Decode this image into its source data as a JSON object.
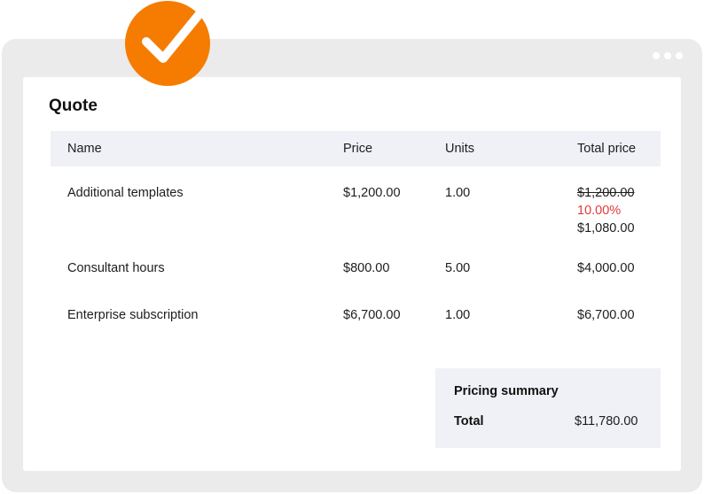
{
  "quote": {
    "title": "Quote",
    "columns": {
      "name": "Name",
      "price": "Price",
      "units": "Units",
      "total": "Total price"
    },
    "rows": [
      {
        "name": "Additional templates",
        "price": "$1,200.00",
        "units": "1.00",
        "original_total": "$1,200.00",
        "discount": "10.00%",
        "total": "$1,080.00"
      },
      {
        "name": "Consultant hours",
        "price": "$800.00",
        "units": "5.00",
        "total": "$4,000.00"
      },
      {
        "name": "Enterprise subscription",
        "price": "$6,700.00",
        "units": "1.00",
        "total": "$6,700.00"
      }
    ],
    "summary": {
      "title": "Pricing summary",
      "total_label": "Total",
      "total_value": "$11,780.00"
    }
  },
  "badge": {
    "icon": "checkmark-icon",
    "color": "#f57c00"
  },
  "colors": {
    "discount": "#e03a3a",
    "header_bg": "#eff1f6",
    "window_bg": "#ebebeb"
  }
}
